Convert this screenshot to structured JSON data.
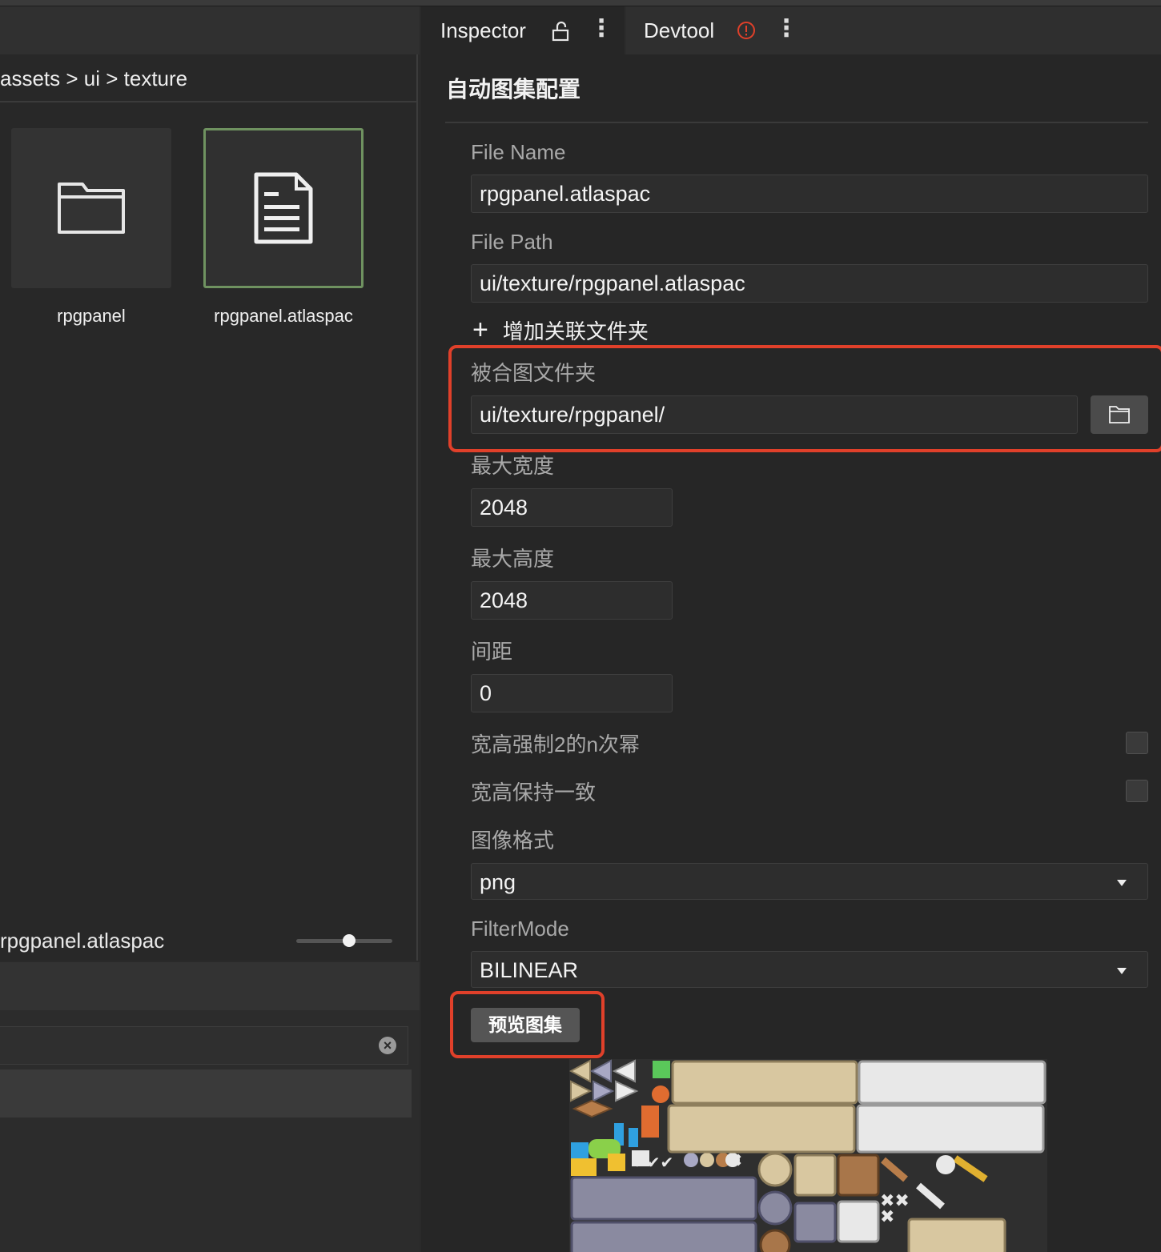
{
  "left": {
    "breadcrumb": "assets > ui > texture",
    "items": [
      {
        "label": "rpgpanel",
        "icon": "folder-icon"
      },
      {
        "label": "rpgpanel.atlaspac",
        "icon": "document-icon"
      }
    ],
    "selected_name": "rpgpanel.atlaspac",
    "zoom_level": 0.55
  },
  "tabs": {
    "inspector": "Inspector",
    "devtool": "Devtool"
  },
  "inspector": {
    "title": "自动图集配置",
    "file_name_label": "File Name",
    "file_name_value": "rpgpanel.atlaspac",
    "file_path_label": "File Path",
    "file_path_value": "ui/texture/rpgpanel.atlaspac",
    "add_folder_label": "增加关联文件夹",
    "packed_folder_label": "被合图文件夹",
    "packed_folder_value": "ui/texture/rpgpanel/",
    "max_width_label": "最大宽度",
    "max_width_value": "2048",
    "max_height_label": "最大高度",
    "max_height_value": "2048",
    "padding_label": "间距",
    "padding_value": "0",
    "pot_label": "宽高强制2的n次幂",
    "pot_checked": false,
    "square_label": "宽高保持一致",
    "square_checked": false,
    "format_label": "图像格式",
    "format_value": "png",
    "filter_label": "FilterMode",
    "filter_value": "BILINEAR",
    "preview_button": "预览图集"
  },
  "colors": {
    "highlight": "#e0402a",
    "selected_border": "#6f9260",
    "warning": "#e0402a"
  }
}
